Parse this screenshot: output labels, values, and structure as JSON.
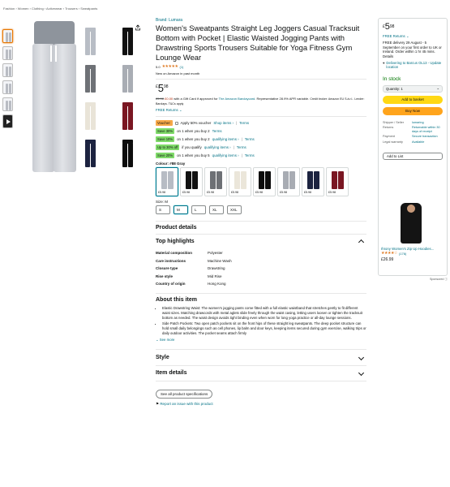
{
  "breadcrumb": "Fashion › Women › Clothing › Activewear › Trousers › Sweatpants",
  "product": {
    "brand": "Brand: Lumara",
    "title": "Women's Sweatpants Straight Leg Joggers Casual Tracksuit Bottom with Pocket | Elastic Waisted Jogging Pants with Drawstring Sports Trousers Suitable for Yoga Fitness Gym Lounge Wear",
    "rating_value": "5.0",
    "rating_stars": "★★★★★",
    "rating_count": "(1)",
    "bought": "New on Amazon in past month",
    "price_currency": "£",
    "price_int": "5",
    "price_dec": "98",
    "offer_strike": "£5.98",
    "offer_red": "£0.00",
    "offer_text": "with a Gift Card if approved for",
    "offer_link": "The Amazon Barclaycard",
    "offer_rest": ". Representative 28.9% APR variable.",
    "offer_fine": "Credit broker: Amazon EU S.à.r.l.. Lender: Barclays. T&Cs apply",
    "free_returns": "FREE Returns ⌄"
  },
  "promos": [
    {
      "badge": "Voucher:",
      "badge_color": "orange",
      "text": "Apply 50% voucher",
      "links": [
        "Shop items ›",
        "Terms"
      ],
      "checkbox": true
    },
    {
      "badge": "Save 30%",
      "badge_color": "green",
      "text": "on 1 when you buy 2",
      "links": [
        "Terms"
      ],
      "checkbox": false
    },
    {
      "badge": "Save 10%",
      "badge_color": "green",
      "text": "on 1 when you buy 2",
      "links": [
        "qualifying items ›",
        "Terms"
      ],
      "checkbox": false
    },
    {
      "badge": "Up to 30% off",
      "badge_color": "green",
      "text": "if you qualify",
      "links": [
        "qualifying items ›",
        "Terms"
      ],
      "checkbox": false
    },
    {
      "badge": "Save 20%",
      "badge_color": "green",
      "text": "on 1 when you buy 5",
      "links": [
        "qualifying items ›",
        "Terms"
      ],
      "checkbox": false
    }
  ],
  "colour": {
    "label": "Colour: #88 Gray",
    "swatches": [
      {
        "color": "#b7bcc4",
        "price": "£5.98",
        "selected": true
      },
      {
        "color": "#111111",
        "price": "£5.98",
        "selected": false
      },
      {
        "color": "#6d7075",
        "price": "£5.98",
        "selected": false
      },
      {
        "color": "#ebe6da",
        "price": "£5.98",
        "selected": false
      },
      {
        "color": "#0d0d0d",
        "price": "£5.98",
        "selected": false
      },
      {
        "color": "#a8acb3",
        "price": "£5.98",
        "selected": false
      },
      {
        "color": "#1c2340",
        "price": "£5.98",
        "selected": false
      },
      {
        "color": "#7a1622",
        "price": "£5.98",
        "selected": false
      }
    ]
  },
  "size": {
    "label": "Size: M",
    "options": [
      "S",
      "M",
      "L",
      "XL",
      "XXL"
    ],
    "selected": "M"
  },
  "details": {
    "heading": "Product details",
    "highlights_heading": "Top highlights",
    "attributes": [
      {
        "k": "Material composition",
        "v": "Polyester"
      },
      {
        "k": "Care instructions",
        "v": "Machine Wash"
      },
      {
        "k": "Closure type",
        "v": "Drawstring"
      },
      {
        "k": "Rise style",
        "v": "Mid Rise"
      },
      {
        "k": "Country of origin",
        "v": "Hong Kong"
      }
    ]
  },
  "about": {
    "heading": "About this item",
    "bullets": [
      "Elastic Drawstring Waist: The women's jogging pants come fitted with a full elastic waistband that stretches gently to fit different waist sizes. Matching drawcords with metal aglets slide freely through the waist casing, letting users loosen or tighten the tracksuit bottom as needed. The waist design avoids tight binding even when worn for long yoga practice or all-day lounge sessions.",
      "Side Patch Pockets: Two open patch pockets sit on the front hips of these straight leg sweatpants. The deep pocket structure can hold small daily belongings such as cell phones, lip balm and door keys, keeping items secured during gym exercise, walking trips or daily outdoor activities. The pocket seams attach firmly"
    ],
    "see_more": "⌄ See more"
  },
  "sections": {
    "style": "Style",
    "item_details": "Item details",
    "all_specs": "See all product specifications",
    "report": "Report an issue with this product"
  },
  "buybox": {
    "price_currency": "£",
    "price_int": "5",
    "price_dec": "98",
    "free_returns": "FREE Returns ⌄",
    "delivery": "FREE delivery 29 August - 5 September on your first order to UK or Ireland. Order within 1 hr 45 mins. Details",
    "location": "Delivering to Barcus OL13 - Update location",
    "in_stock": "In stock",
    "quantity": "Quantity: 1",
    "add_to_basket": "Add to basket",
    "buy_now": "Buy Now",
    "seller_rows": [
      {
        "k": "Shipper / Seller",
        "v": "lumaring"
      },
      {
        "k": "Returns",
        "v": "Returnable within 30 days of receipt"
      },
      {
        "k": "Payment",
        "v": "Secure transaction"
      },
      {
        "k": "Legal warranty",
        "v": "Available"
      }
    ],
    "add_to_list": "Add to List"
  },
  "ad": {
    "title": "Ihrony Women's Zip Up Hoodies...",
    "stars": "★★★★☆",
    "count": "(176)",
    "price": "£26.99",
    "sponsored": "Sponsored ⓘ"
  }
}
